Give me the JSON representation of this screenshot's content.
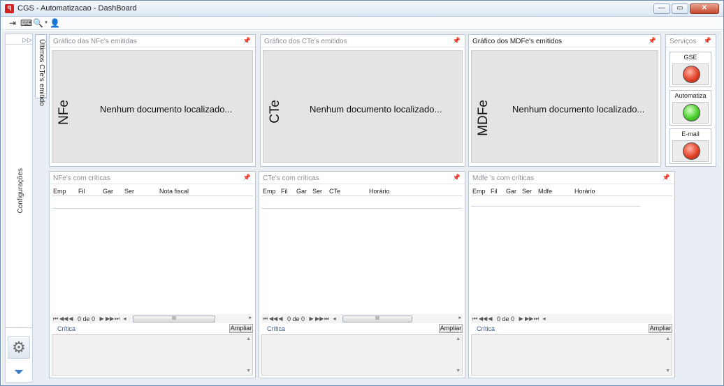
{
  "window": {
    "title": "CGS - Automatizacao - DashBoard"
  },
  "leftbar": {
    "config_label": "Configurações",
    "side_tab_label": "Últimos CTe's emitido"
  },
  "charts": [
    {
      "title": "Gráfico das NFe's emitidas",
      "vlabel": "NFe",
      "message": "Nenhum documento localizado..."
    },
    {
      "title": "Gráfico dos CTe's emitidos",
      "vlabel": "CTe",
      "message": "Nenhum documento localizado..."
    },
    {
      "title": "Gráfico dos MDFe's emitidos",
      "vlabel": "MDFe",
      "message": "Nenhum documento localizado..."
    }
  ],
  "services": {
    "title": "Serviços",
    "items": [
      {
        "label": "GSE",
        "status": "red"
      },
      {
        "label": "Automatiza",
        "status": "green"
      },
      {
        "label": "E-mail",
        "status": "red"
      }
    ]
  },
  "grids": [
    {
      "title": "NFe's com críticas",
      "columns": [
        "Emp",
        "Fil",
        "Gar",
        "Ser",
        "Nota fiscal"
      ],
      "pager": "0 de 0",
      "scroll_grip": "III",
      "critica_label": "Crítica",
      "ampliar_label": "Ampliar"
    },
    {
      "title": "CTe's com críticas",
      "columns": [
        "Emp",
        "Fil",
        "Gar",
        "Ser",
        "CTe",
        "Horário"
      ],
      "pager": "0 de 0",
      "scroll_grip": "III",
      "critica_label": "Crítica",
      "ampliar_label": "Ampliar"
    },
    {
      "title": "Mdfe 's com críticas",
      "columns": [
        "Emp",
        "Fil",
        "Gar",
        "Ser",
        "Mdfe",
        "Horário"
      ],
      "pager": "0 de 0",
      "critica_label": "Crítica",
      "ampliar_label": "Ampliar"
    }
  ],
  "colors": {
    "status_red": "#e2432a",
    "status_green": "#4cd12e",
    "link_blue": "#3b5d8f"
  }
}
